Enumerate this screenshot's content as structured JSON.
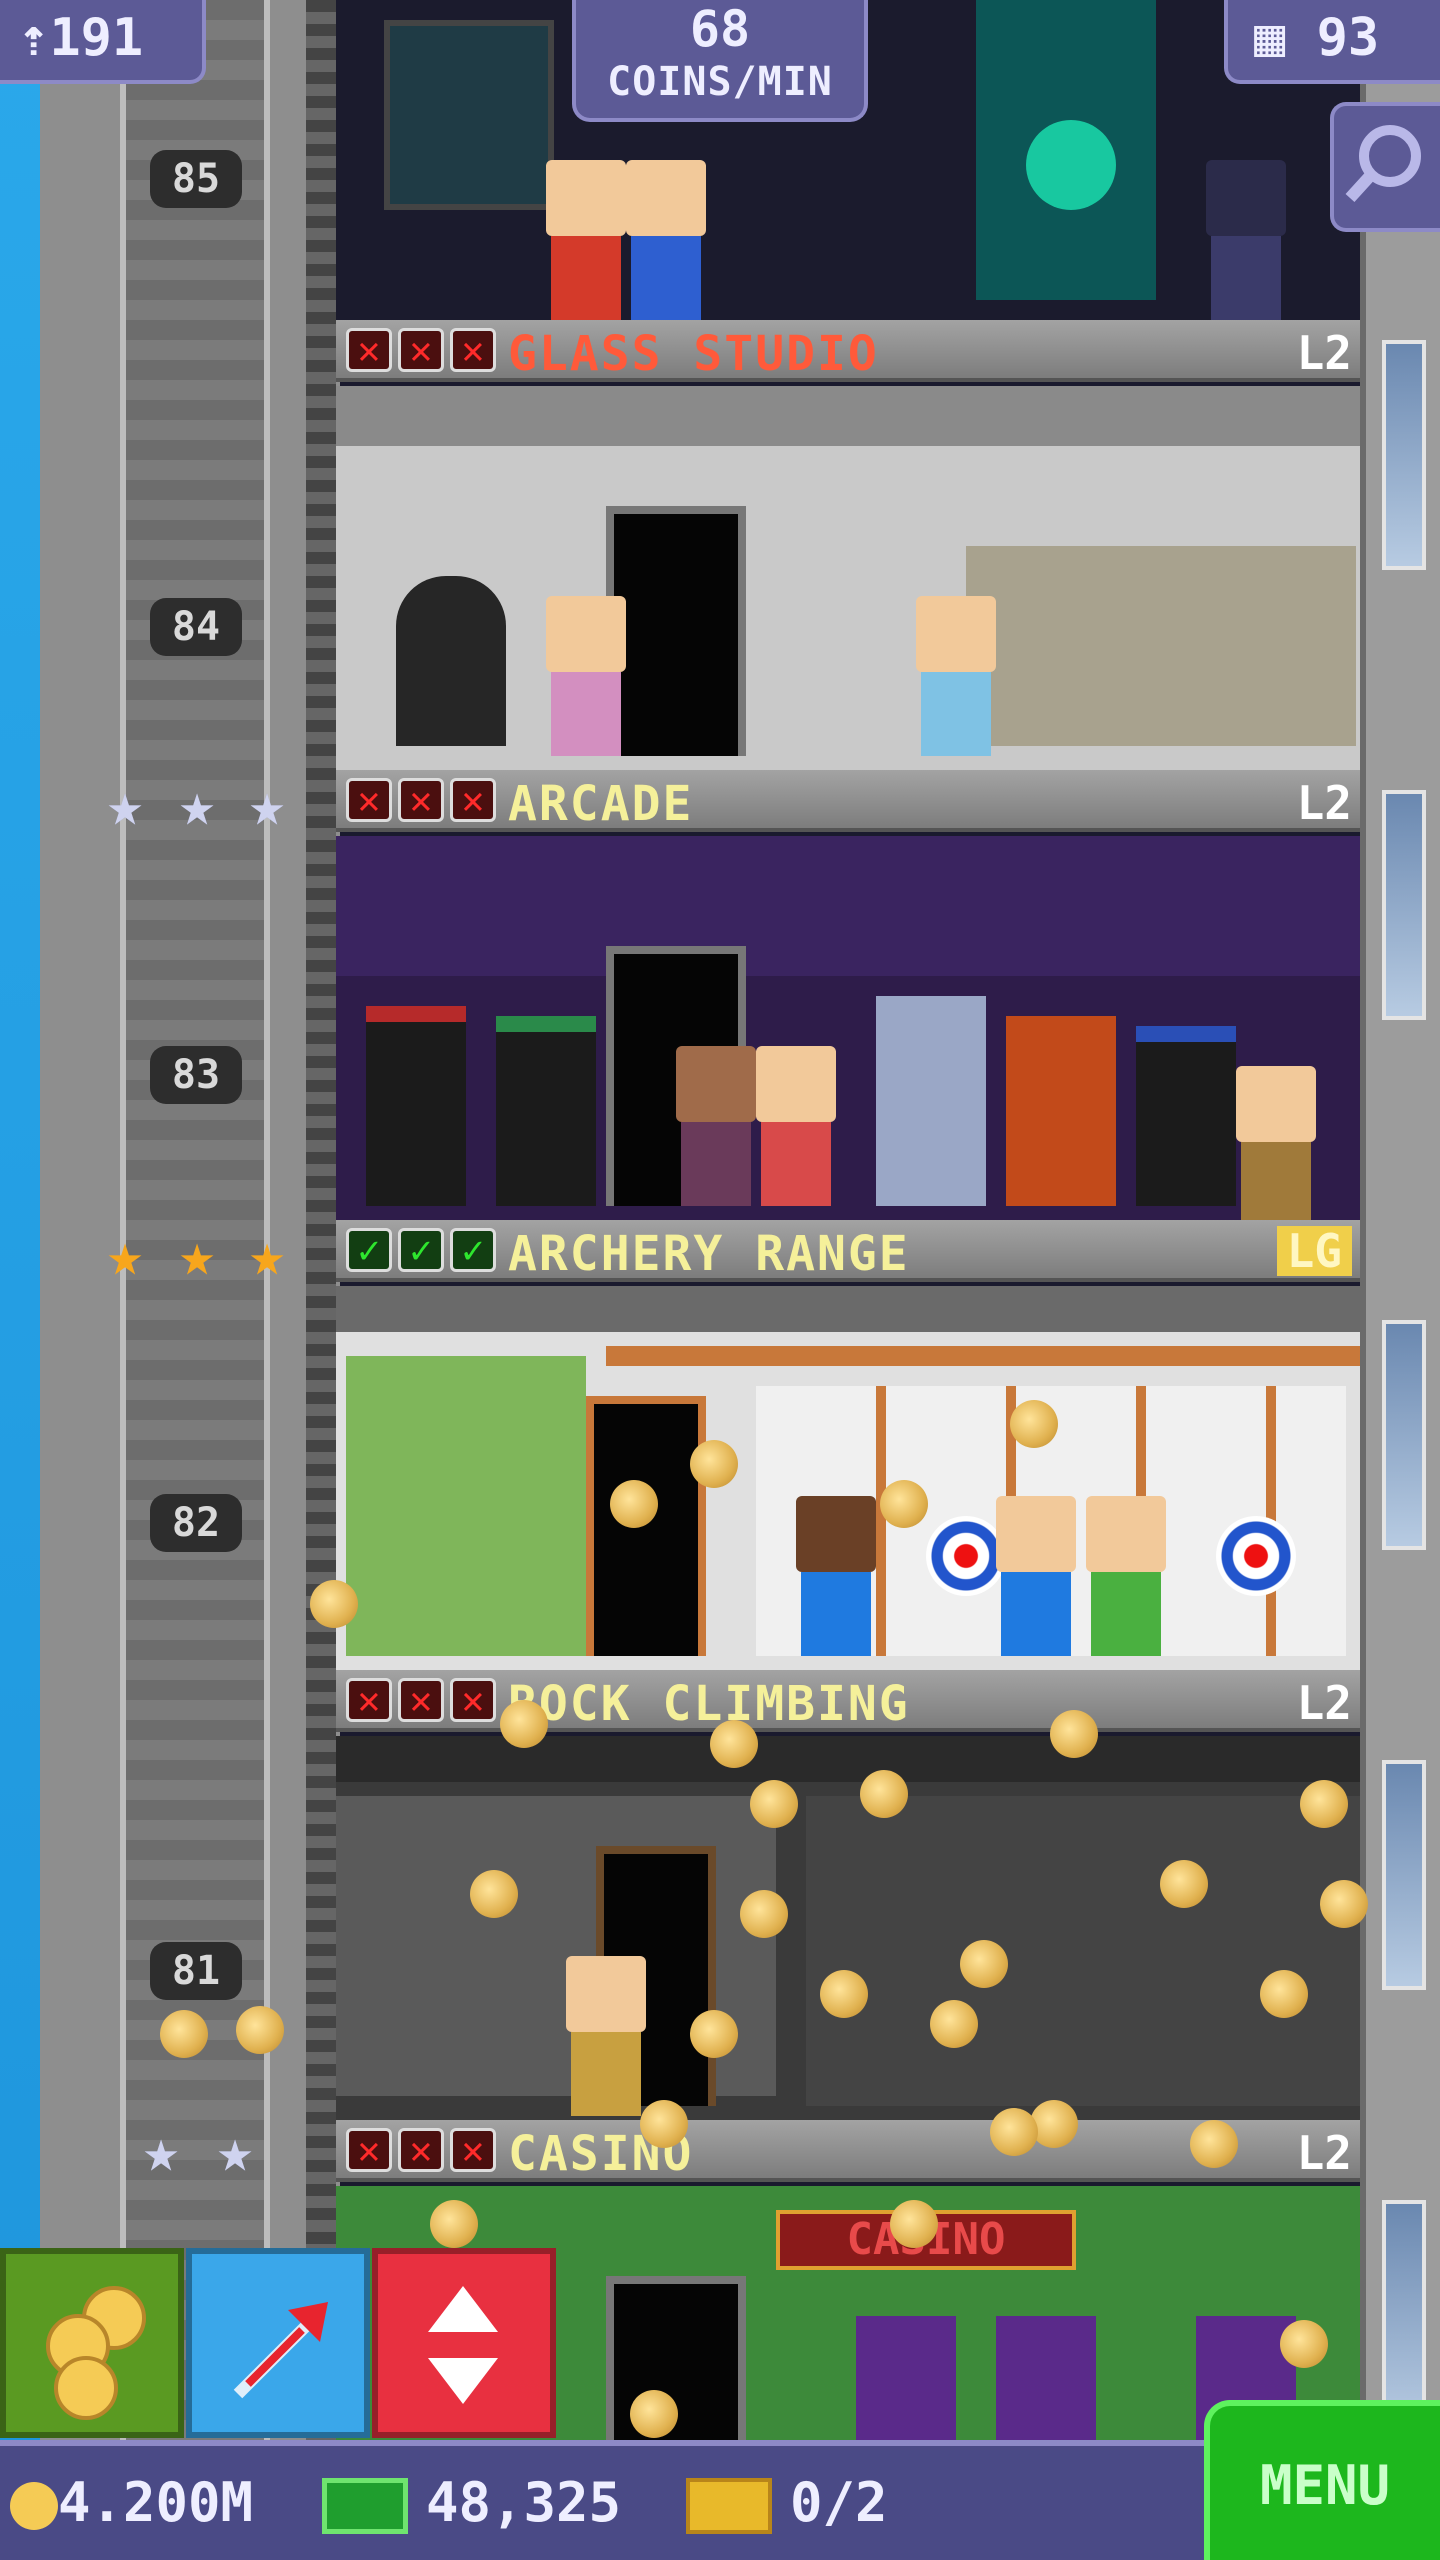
{
  "hud": {
    "population": "191",
    "rate_value": "68",
    "rate_unit": "COINS/MIN",
    "floors_count": "93"
  },
  "floor_numbers": [
    "85",
    "84",
    "83",
    "82",
    "81"
  ],
  "rooms": [
    {
      "name": "GLASS STUDIO",
      "level": "L2",
      "marks": "xxx",
      "title_color": "#ff5a3a"
    },
    {
      "name": "ARCADE",
      "level": "L2",
      "marks": "xxx",
      "title_color": "#f5f09a"
    },
    {
      "name": "ARCHERY RANGE",
      "level": "LG",
      "marks": "ok",
      "title_color": "#f5f09a"
    },
    {
      "name": "ROCK CLIMBING",
      "level": "L2",
      "marks": "xxx",
      "title_color": "#f5f09a"
    },
    {
      "name": "CASINO",
      "level": "L2",
      "marks": "xxx",
      "title_color": "#f5f09a"
    }
  ],
  "room_signs": {
    "casino_sign": "CASINO"
  },
  "bottom": {
    "coins": "4.200M",
    "bux": "48,325",
    "tickets": "0/2",
    "menu_label": "MENU"
  },
  "icons": {
    "population": "person-up-icon",
    "floors": "building-icon",
    "magnifier": "magnifier-icon",
    "coins_button": "coins-icon",
    "dig_button": "dig-arrow-icon",
    "elevator_button": "elevator-up-down-icon",
    "coin": "coin-icon",
    "bux": "bux-icon",
    "ticket": "ticket-icon"
  },
  "colors": {
    "hud_bg": "#5c5a96",
    "menu_green": "#1db71d",
    "mark_red": "#ff2a2a",
    "mark_green": "#2ee62e",
    "star_gold": "#f7a61c",
    "star_silver": "#cfd3ef"
  }
}
